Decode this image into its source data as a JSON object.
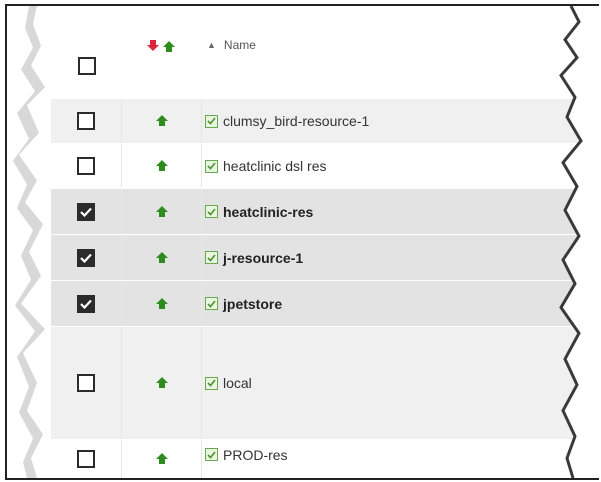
{
  "header": {
    "name_label": "Name"
  },
  "rows": [
    {
      "name": "clumsy_bird-resource-1",
      "checked": false,
      "bold": false
    },
    {
      "name": "heatclinic dsl res",
      "checked": false,
      "bold": false
    },
    {
      "name": "heatclinic-res",
      "checked": true,
      "bold": true
    },
    {
      "name": "j-resource-1",
      "checked": true,
      "bold": true
    },
    {
      "name": "jpetstore",
      "checked": true,
      "bold": true
    },
    {
      "name": "local",
      "checked": false,
      "bold": false
    },
    {
      "name": "PROD-res",
      "checked": false,
      "bold": false
    }
  ],
  "colors": {
    "up_arrow": "#2e8b1e",
    "down_arrow": "#d9263a",
    "resource_check": "#6aa84f"
  }
}
